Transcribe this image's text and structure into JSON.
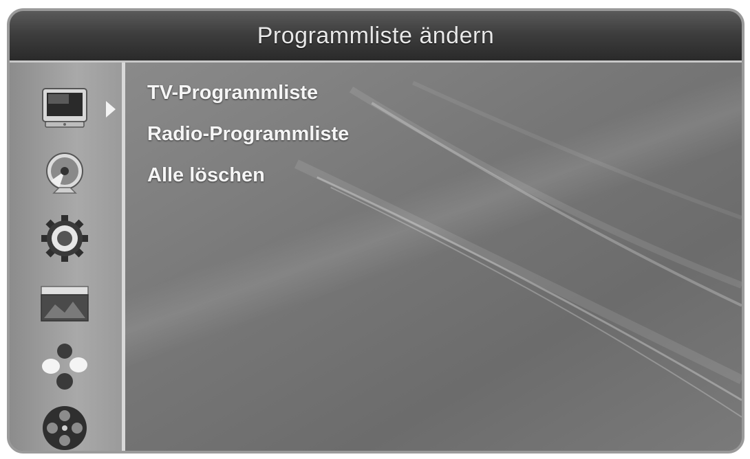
{
  "title": "Programmliste ändern",
  "sidebar": {
    "icons": [
      "tv-icon",
      "satellite-dish-icon",
      "gear-icon",
      "media-box-icon",
      "game-balls-icon",
      "film-reel-icon"
    ],
    "selected_index": 0
  },
  "menu": {
    "items": [
      {
        "label": "TV-Programmliste"
      },
      {
        "label": "Radio-Programmliste"
      },
      {
        "label": "Alle löschen"
      }
    ]
  }
}
